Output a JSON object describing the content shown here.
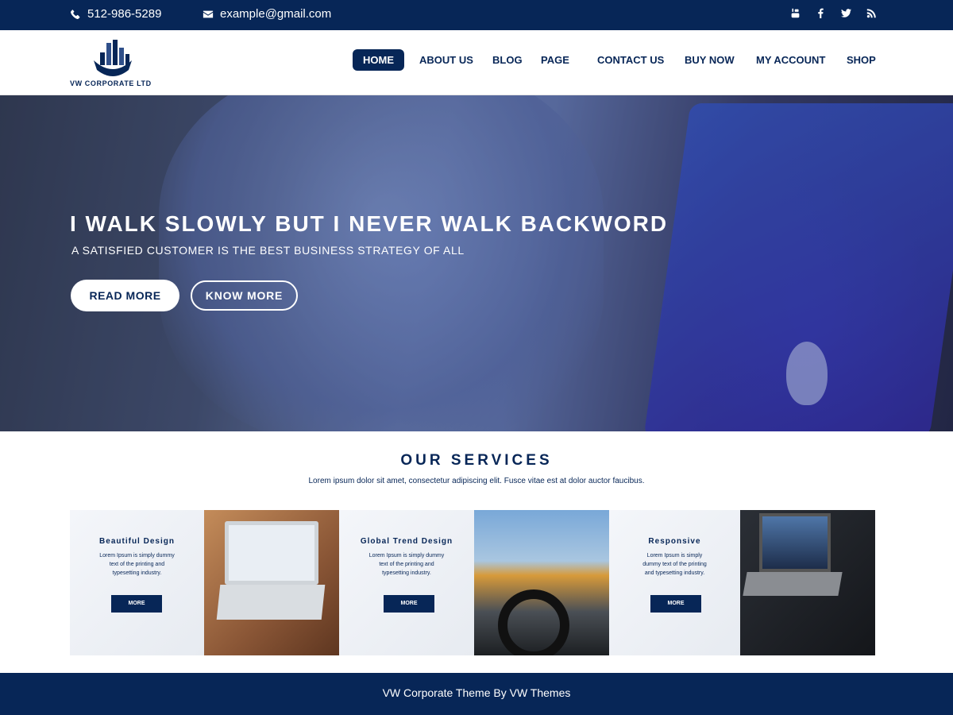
{
  "topbar": {
    "phone": "512-986-5289",
    "email": "example@gmail.com",
    "social_icons": [
      "youtube-icon",
      "facebook-icon",
      "twitter-icon",
      "rss-icon"
    ]
  },
  "header": {
    "logo_text": "VW CORPORATE LTD",
    "nav": [
      {
        "label": "HOME",
        "active": true
      },
      {
        "label": "ABOUT US"
      },
      {
        "label": "BLOG"
      },
      {
        "label": "PAGE"
      },
      {
        "label": "CONTACT US"
      },
      {
        "label": "BUY NOW"
      },
      {
        "label": "MY ACCOUNT"
      },
      {
        "label": "SHOP"
      }
    ]
  },
  "hero": {
    "title": "I WALK SLOWLY BUT I NEVER WALK BACKWORD",
    "subtitle": "A SATISFIED CUSTOMER IS THE BEST BUSINESS STRATEGY OF ALL",
    "read_more": "READ MORE",
    "know_more": "KNOW MORE"
  },
  "services": {
    "title": "OUR SERVICES",
    "description": "Lorem ipsum dolor sit amet, consectetur adipiscing elit. Fusce vitae est at dolor auctor faucibus.",
    "items": [
      {
        "title": "Beautiful Design",
        "text": "Lorem Ipsum is simply dummy text of the printing and typesetting industry.",
        "button": "MORE"
      },
      {
        "title": "Global Trend Design",
        "text": "Lorem Ipsum is simply dummy text of the printing and typesetting industry.",
        "button": "MORE"
      },
      {
        "title": "Responsive",
        "text": "Lorem Ipsum is simply dummy text of the printing and typesetting industry.",
        "button": "MORE"
      }
    ]
  },
  "footer": {
    "text": "VW Corporate Theme By VW Themes"
  },
  "colors": {
    "brand": "#072657",
    "white": "#ffffff"
  }
}
